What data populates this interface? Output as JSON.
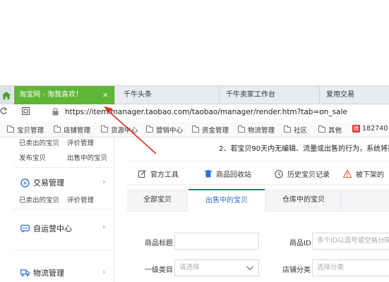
{
  "browser": {
    "tabs": [
      {
        "label": "淘宝网 - 淘我喜欢！",
        "active": true
      },
      {
        "label": "千牛头条",
        "active": false
      },
      {
        "label": "千牛卖家工作台",
        "active": false
      },
      {
        "label": "爱用交易",
        "active": false
      }
    ],
    "tab_close": "×",
    "url": "https://item.manager.taobao.com/taobao/manager/render.htm?tab=on_sale",
    "bookmarks": [
      "宝贝管理",
      "店铺管理",
      "货源中心",
      "营销中心",
      "资金管理",
      "物流管理",
      "社区",
      "其他"
    ],
    "bookmark_phone": "182740",
    "accent": "#5fb535"
  },
  "sidebar": {
    "top_links": [
      "已卖出的宝贝",
      "评价管理"
    ],
    "row2_links": [
      "发布宝贝",
      "出售中的宝贝"
    ],
    "trade": {
      "title": "交易管理",
      "links": [
        "已卖出的宝贝",
        "评价管理"
      ]
    },
    "self_center": {
      "title": "自运营中心"
    },
    "logistics": {
      "title": "物流管理"
    }
  },
  "main": {
    "notice": "2、若宝贝90天内无编辑、流量或出售的行为，系统将把宝",
    "tools": [
      "官方工具",
      "商品回收站",
      "历史宝贝记录",
      "被下架的"
    ],
    "subtabs": [
      "全部宝贝",
      "出售中的宝贝",
      "仓库中的宝贝"
    ],
    "active_color": "#2f6ed8",
    "form": {
      "title_label": "商品标题",
      "title_value": "",
      "id_label": "商品ID",
      "id_placeholder": "多个ID以逗号或空格分隔",
      "category_label": "一级类目",
      "category_value": "请选择",
      "shop_category_label": "店铺分类",
      "shop_category_value": "选择分类"
    }
  },
  "annotation": {
    "arrow_color": "#d9362b"
  }
}
